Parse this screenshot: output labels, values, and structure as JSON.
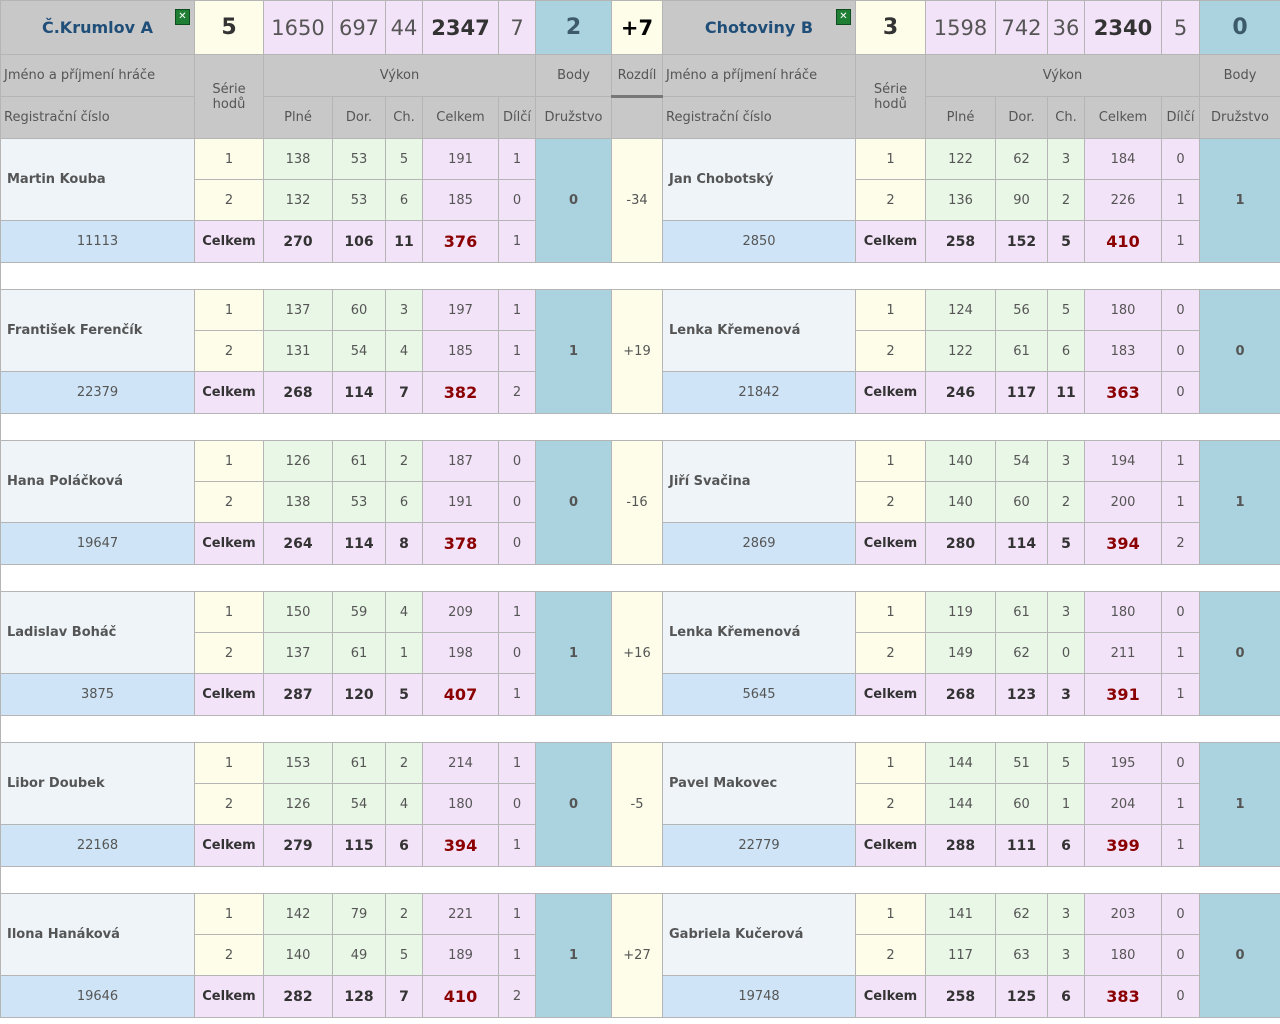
{
  "header": {
    "home": {
      "name": "Č.Krumlov A",
      "score": "5",
      "full": "1650",
      "clear": "697",
      "misses": "44",
      "total": "2347",
      "partial": "7",
      "points": "2"
    },
    "diff": "+7",
    "away": {
      "name": "Chotoviny B",
      "score": "3",
      "full": "1598",
      "clear": "742",
      "misses": "36",
      "total": "2340",
      "partial": "5",
      "points": "0"
    }
  },
  "labels": {
    "player_name": "Jméno a příjmení hráče",
    "reg_number": "Registrační číslo",
    "series": "Série hodů",
    "performance": "Výkon",
    "points": "Body",
    "diff": "Rozdíl",
    "full": "Plné",
    "clear": "Dor.",
    "misses": "Ch.",
    "total": "Celkem",
    "partial": "Dílčí",
    "team": "Družstvo",
    "total_row": "Celkem"
  },
  "matches": [
    {
      "home": {
        "name": "Martin Kouba",
        "reg": "11113",
        "r1": {
          "s": "1",
          "p": "138",
          "d": "53",
          "c": "5",
          "t": "191",
          "dp": "1"
        },
        "r2": {
          "s": "2",
          "p": "132",
          "d": "53",
          "c": "6",
          "t": "185",
          "dp": "0"
        },
        "tot": {
          "p": "270",
          "d": "106",
          "c": "11",
          "t": "376",
          "dp": "1"
        },
        "pts": "0"
      },
      "diff": "-34",
      "away": {
        "name": "Jan Chobotský",
        "reg": "2850",
        "r1": {
          "s": "1",
          "p": "122",
          "d": "62",
          "c": "3",
          "t": "184",
          "dp": "0"
        },
        "r2": {
          "s": "2",
          "p": "136",
          "d": "90",
          "c": "2",
          "t": "226",
          "dp": "1"
        },
        "tot": {
          "p": "258",
          "d": "152",
          "c": "5",
          "t": "410",
          "dp": "1"
        },
        "pts": "1"
      }
    },
    {
      "home": {
        "name": "František Ferenčík",
        "reg": "22379",
        "r1": {
          "s": "1",
          "p": "137",
          "d": "60",
          "c": "3",
          "t": "197",
          "dp": "1"
        },
        "r2": {
          "s": "2",
          "p": "131",
          "d": "54",
          "c": "4",
          "t": "185",
          "dp": "1"
        },
        "tot": {
          "p": "268",
          "d": "114",
          "c": "7",
          "t": "382",
          "dp": "2"
        },
        "pts": "1"
      },
      "diff": "+19",
      "away": {
        "name": "Lenka Křemenová",
        "reg": "21842",
        "r1": {
          "s": "1",
          "p": "124",
          "d": "56",
          "c": "5",
          "t": "180",
          "dp": "0"
        },
        "r2": {
          "s": "2",
          "p": "122",
          "d": "61",
          "c": "6",
          "t": "183",
          "dp": "0"
        },
        "tot": {
          "p": "246",
          "d": "117",
          "c": "11",
          "t": "363",
          "dp": "0"
        },
        "pts": "0"
      }
    },
    {
      "home": {
        "name": "Hana Poláčková",
        "reg": "19647",
        "r1": {
          "s": "1",
          "p": "126",
          "d": "61",
          "c": "2",
          "t": "187",
          "dp": "0"
        },
        "r2": {
          "s": "2",
          "p": "138",
          "d": "53",
          "c": "6",
          "t": "191",
          "dp": "0"
        },
        "tot": {
          "p": "264",
          "d": "114",
          "c": "8",
          "t": "378",
          "dp": "0"
        },
        "pts": "0"
      },
      "diff": "-16",
      "away": {
        "name": "Jiří Svačina",
        "reg": "2869",
        "r1": {
          "s": "1",
          "p": "140",
          "d": "54",
          "c": "3",
          "t": "194",
          "dp": "1"
        },
        "r2": {
          "s": "2",
          "p": "140",
          "d": "60",
          "c": "2",
          "t": "200",
          "dp": "1"
        },
        "tot": {
          "p": "280",
          "d": "114",
          "c": "5",
          "t": "394",
          "dp": "2"
        },
        "pts": "1"
      }
    },
    {
      "home": {
        "name": "Ladislav Boháč",
        "reg": "3875",
        "r1": {
          "s": "1",
          "p": "150",
          "d": "59",
          "c": "4",
          "t": "209",
          "dp": "1"
        },
        "r2": {
          "s": "2",
          "p": "137",
          "d": "61",
          "c": "1",
          "t": "198",
          "dp": "0"
        },
        "tot": {
          "p": "287",
          "d": "120",
          "c": "5",
          "t": "407",
          "dp": "1"
        },
        "pts": "1"
      },
      "diff": "+16",
      "away": {
        "name": "Lenka Křemenová",
        "reg": "5645",
        "r1": {
          "s": "1",
          "p": "119",
          "d": "61",
          "c": "3",
          "t": "180",
          "dp": "0"
        },
        "r2": {
          "s": "2",
          "p": "149",
          "d": "62",
          "c": "0",
          "t": "211",
          "dp": "1"
        },
        "tot": {
          "p": "268",
          "d": "123",
          "c": "3",
          "t": "391",
          "dp": "1"
        },
        "pts": "0"
      }
    },
    {
      "home": {
        "name": "Libor Doubek",
        "reg": "22168",
        "r1": {
          "s": "1",
          "p": "153",
          "d": "61",
          "c": "2",
          "t": "214",
          "dp": "1"
        },
        "r2": {
          "s": "2",
          "p": "126",
          "d": "54",
          "c": "4",
          "t": "180",
          "dp": "0"
        },
        "tot": {
          "p": "279",
          "d": "115",
          "c": "6",
          "t": "394",
          "dp": "1"
        },
        "pts": "0"
      },
      "diff": "-5",
      "away": {
        "name": "Pavel Makovec",
        "reg": "22779",
        "r1": {
          "s": "1",
          "p": "144",
          "d": "51",
          "c": "5",
          "t": "195",
          "dp": "0"
        },
        "r2": {
          "s": "2",
          "p": "144",
          "d": "60",
          "c": "1",
          "t": "204",
          "dp": "1"
        },
        "tot": {
          "p": "288",
          "d": "111",
          "c": "6",
          "t": "399",
          "dp": "1"
        },
        "pts": "1"
      }
    },
    {
      "home": {
        "name": "Ilona Hanáková",
        "reg": "19646",
        "r1": {
          "s": "1",
          "p": "142",
          "d": "79",
          "c": "2",
          "t": "221",
          "dp": "1"
        },
        "r2": {
          "s": "2",
          "p": "140",
          "d": "49",
          "c": "5",
          "t": "189",
          "dp": "1"
        },
        "tot": {
          "p": "282",
          "d": "128",
          "c": "7",
          "t": "410",
          "dp": "2"
        },
        "pts": "1"
      },
      "diff": "+27",
      "away": {
        "name": "Gabriela Kučerová",
        "reg": "19748",
        "r1": {
          "s": "1",
          "p": "141",
          "d": "62",
          "c": "3",
          "t": "203",
          "dp": "0"
        },
        "r2": {
          "s": "2",
          "p": "117",
          "d": "63",
          "c": "3",
          "t": "180",
          "dp": "0"
        },
        "tot": {
          "p": "258",
          "d": "125",
          "c": "6",
          "t": "383",
          "dp": "0"
        },
        "pts": "0"
      }
    }
  ]
}
